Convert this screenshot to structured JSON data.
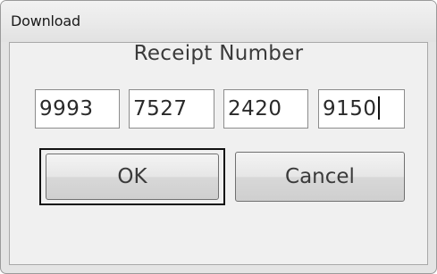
{
  "window": {
    "title": "Download"
  },
  "dialog": {
    "heading": "Receipt Number",
    "fields": [
      "9993",
      "7527",
      "2420",
      "9150"
    ],
    "ok_label": "OK",
    "cancel_label": "Cancel"
  }
}
